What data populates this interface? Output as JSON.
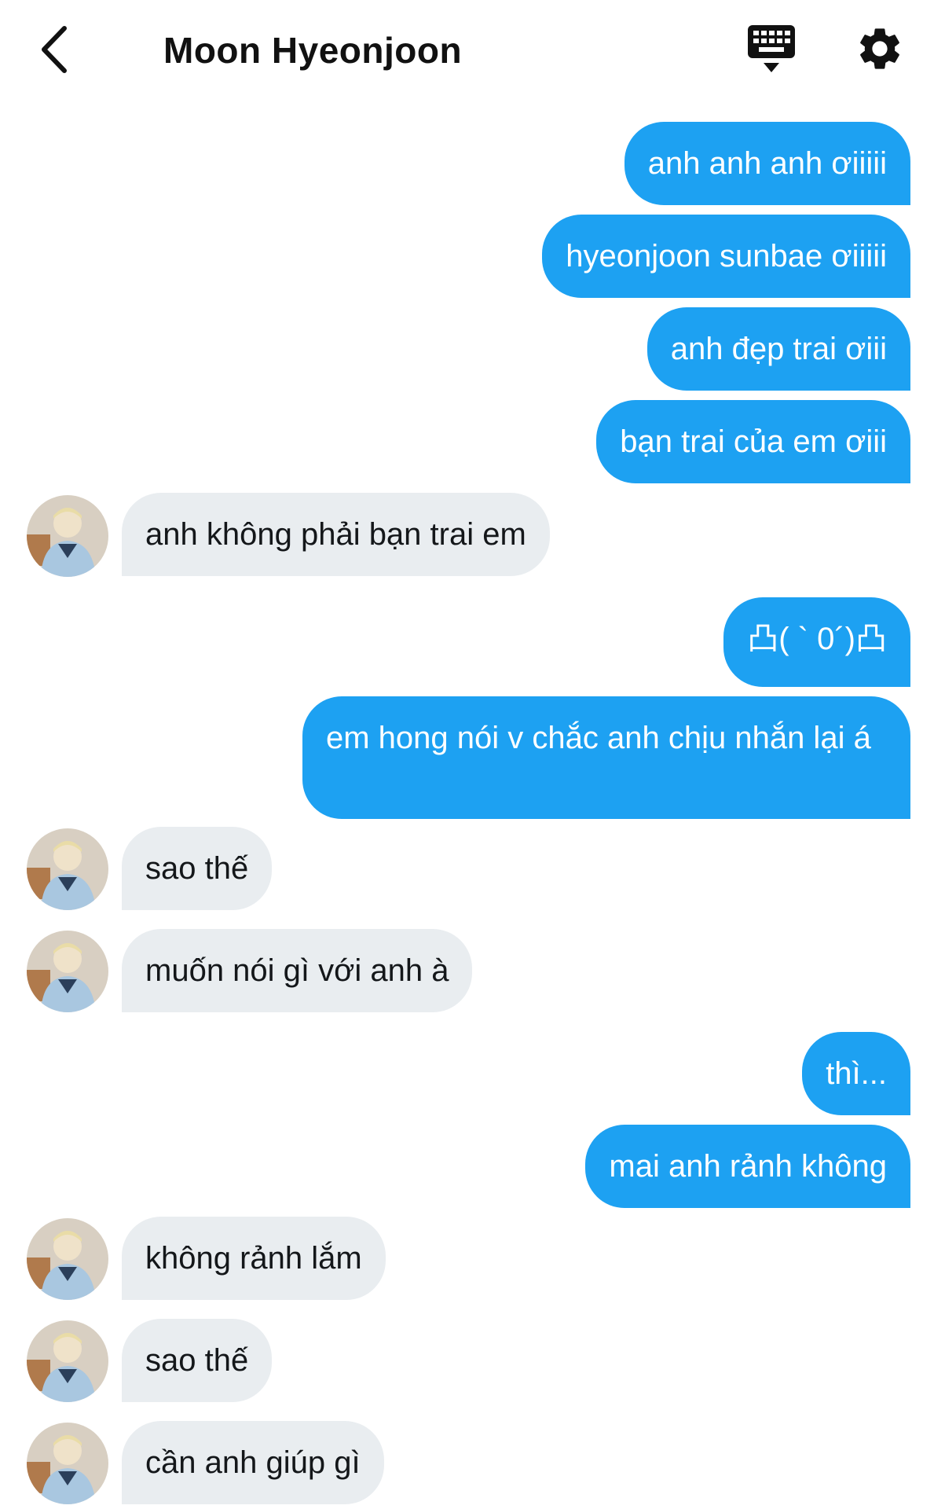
{
  "header": {
    "title": "Moon Hyeonjoon",
    "back_icon": "chevron-left-icon",
    "keyboard_icon": "keyboard-icon",
    "settings_icon": "gear-icon"
  },
  "colors": {
    "sent_bubble": "#1da1f2",
    "received_bubble": "#e9edf0"
  },
  "messages": [
    {
      "from": "me",
      "text": "anh anh anh ơiiiii"
    },
    {
      "from": "me",
      "text": "hyeonjoon sunbae ơiiiii"
    },
    {
      "from": "me",
      "text": "anh đẹp trai ơiii"
    },
    {
      "from": "me",
      "text": "bạn trai của em ơiii"
    },
    {
      "from": "them",
      "text": "anh không phải bạn trai em"
    },
    {
      "from": "me",
      "text": "凸( ` 0´)凸"
    },
    {
      "from": "me",
      "text": "em hong nói v chắc anh chịu nhắn lại á"
    },
    {
      "from": "them",
      "text": "sao thế"
    },
    {
      "from": "them",
      "text": "muốn nói gì với anh à"
    },
    {
      "from": "me",
      "text": "thì..."
    },
    {
      "from": "me",
      "text": "mai anh rảnh không"
    },
    {
      "from": "them",
      "text": "không rảnh lắm"
    },
    {
      "from": "them",
      "text": "sao thế"
    },
    {
      "from": "them",
      "text": "cần anh giúp gì"
    }
  ]
}
